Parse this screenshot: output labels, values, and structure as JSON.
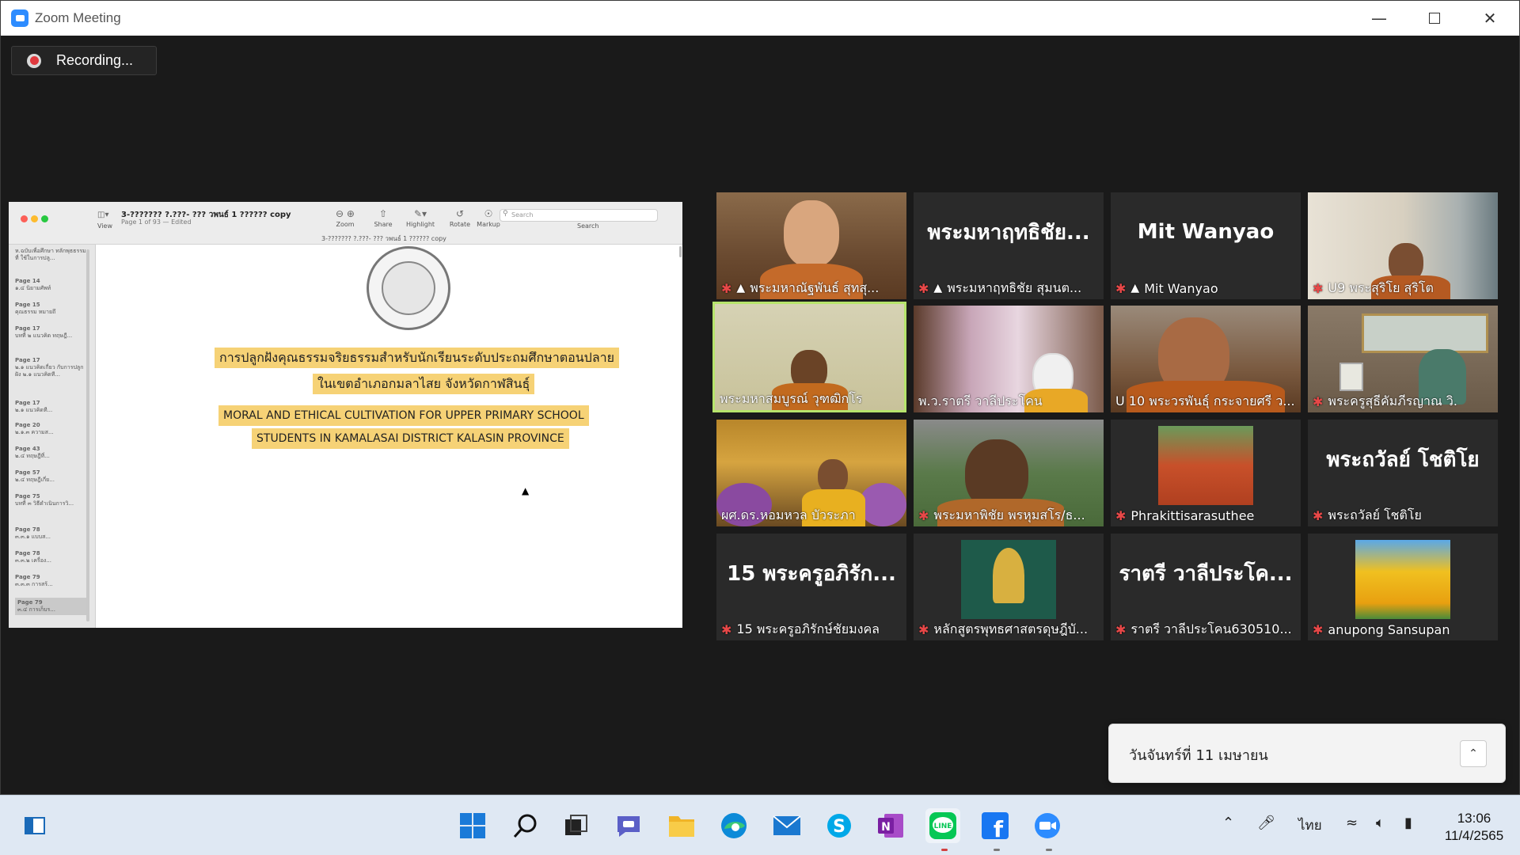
{
  "window": {
    "title": "Zoom Meeting"
  },
  "recording": {
    "label": "Recording..."
  },
  "shared_doc": {
    "title": "3-??????? ?.???- ??? วพนธ์ 1 ?????? copy",
    "subtitle": "Page 1 of 93 — Edited",
    "center_name": "3-??????? ?.???- ??? วพนธ์ 1 ?????? copy",
    "view_label": "View",
    "search_placeholder": "Search",
    "search_label": "Search",
    "tools": [
      "Zoom",
      "Share",
      "Highlight",
      "Rotate",
      "Markup"
    ],
    "sidebar": [
      {
        "page": "",
        "text": "ห.ฉบับเพื่อศึกษา ทลักพุธธรรมที่ ใช้ในการปลู..."
      },
      {
        "page": "Page 14",
        "text": "๑.๔ นิยามศัพท์"
      },
      {
        "page": "Page 15",
        "text": "คุณธรรม หมายถึ"
      },
      {
        "page": "Page 17",
        "text": "บทที่ ๒ แนวคิด ทฤษฎี..."
      },
      {
        "page": "Page 17",
        "text": "๒.๑ แนวคิดเกี่ยว กับการปลูกฝัง ๒.๑ แนวคิดที..."
      },
      {
        "page": "Page 17",
        "text": "๒.๑ แนวคิดที..."
      },
      {
        "page": "Page 20",
        "text": "๒.๑.๓ ความส..."
      },
      {
        "page": "Page 43",
        "text": "๒.๔ ทฤษฎีที่..."
      },
      {
        "page": "Page 57",
        "text": "๒.๔ ทฤษฎีเกี่ย..."
      },
      {
        "page": "Page 75",
        "text": "บทที่ ๓ วิธีดำเนินการวิ..."
      },
      {
        "page": "Page 78",
        "text": "๓.๓.๑ แบบส..."
      },
      {
        "page": "Page 78",
        "text": "๓.๓.๒ เครื่อง..."
      },
      {
        "page": "Page 79",
        "text": "๓.๓.๓ การสร้..."
      },
      {
        "page": "Page 79",
        "text": "๓.๔ การเก็บร..."
      }
    ],
    "thai_title_line1": "การปลูกฝังคุณธรรมจริยธรรมสำหรับนักเรียนระดับประถมศึกษาตอนปลาย",
    "thai_title_line2": "ในเขตอำเภอกมลาไสย จังหวัดกาฬสินธุ์",
    "eng_title_line1": "MORAL AND ETHICAL CULTIVATION FOR UPPER PRIMARY SCHOOL",
    "eng_title_line2": "STUDENTS IN KAMALASAI DISTRICT KALASIN PROVINCE"
  },
  "participants": [
    {
      "name": "พระมหาณัฐพันธ์ สุทสุ...",
      "muted": true,
      "pinned": true,
      "big": ""
    },
    {
      "name": "พระมหาฤทธิชัย สุมนต...",
      "muted": true,
      "pinned": true,
      "big": "พระมหาฤทธิชัย..."
    },
    {
      "name": "Mit Wanyao",
      "muted": true,
      "pinned": true,
      "big": "Mit Wanyao"
    },
    {
      "name": "U9 พระสุริโย สุริโต",
      "muted": true,
      "pinned": false,
      "big": ""
    },
    {
      "name": "พระมหาสมบูรณ์ วุฑฒิกโร",
      "muted": false,
      "pinned": false,
      "big": ""
    },
    {
      "name": "พ.ว.ราตรี วาลีประโคน",
      "muted": false,
      "pinned": false,
      "big": ""
    },
    {
      "name": "U 10 พระวรพันธุ์ กระจายศรี ว...",
      "muted": false,
      "pinned": false,
      "big": ""
    },
    {
      "name": "พระครูสุธีคัมภีรญาณ วิ.",
      "muted": true,
      "pinned": false,
      "big": ""
    },
    {
      "name": "ผศ.ดร.หอมหวล บัวระภา",
      "muted": false,
      "pinned": false,
      "big": ""
    },
    {
      "name": "พระมหาพิชัย พรหุมสโร/ธ...",
      "muted": true,
      "pinned": false,
      "big": ""
    },
    {
      "name": "Phrakittisarasuthee",
      "muted": true,
      "pinned": false,
      "big": ""
    },
    {
      "name": "พระถวัลย์ โชติโย",
      "muted": true,
      "pinned": false,
      "big": "พระถวัลย์ โชติโย"
    },
    {
      "name": "15 พระครูอภิรักษ์ชัยมงคล",
      "muted": true,
      "pinned": false,
      "big": "15 พระครูอภิรัก..."
    },
    {
      "name": "หลักสูตรพุทธศาสตรดุษฎีบั...",
      "muted": true,
      "pinned": false,
      "big": ""
    },
    {
      "name": "ราตรี วาลีประโคน630510...",
      "muted": true,
      "pinned": false,
      "big": "ราตรี วาลีประโค..."
    },
    {
      "name": "anupong Sansupan",
      "muted": true,
      "pinned": false,
      "big": ""
    }
  ],
  "notification": {
    "text": "วันจันทร์ที่ 11 เมษายน"
  },
  "taskbar": {
    "apps": [
      "start",
      "search",
      "task-view",
      "teams-chat",
      "file-explorer",
      "edge",
      "mail",
      "skype",
      "onenote",
      "line",
      "facebook",
      "zoom"
    ],
    "tray": {
      "lang": "ไทย"
    },
    "time": "13:06",
    "date": "11/4/2565"
  },
  "colors": {
    "accent": "#2d8cff",
    "active_speaker": "#b6e46c",
    "muted": "#e84848",
    "highlight": "#f6d276"
  }
}
